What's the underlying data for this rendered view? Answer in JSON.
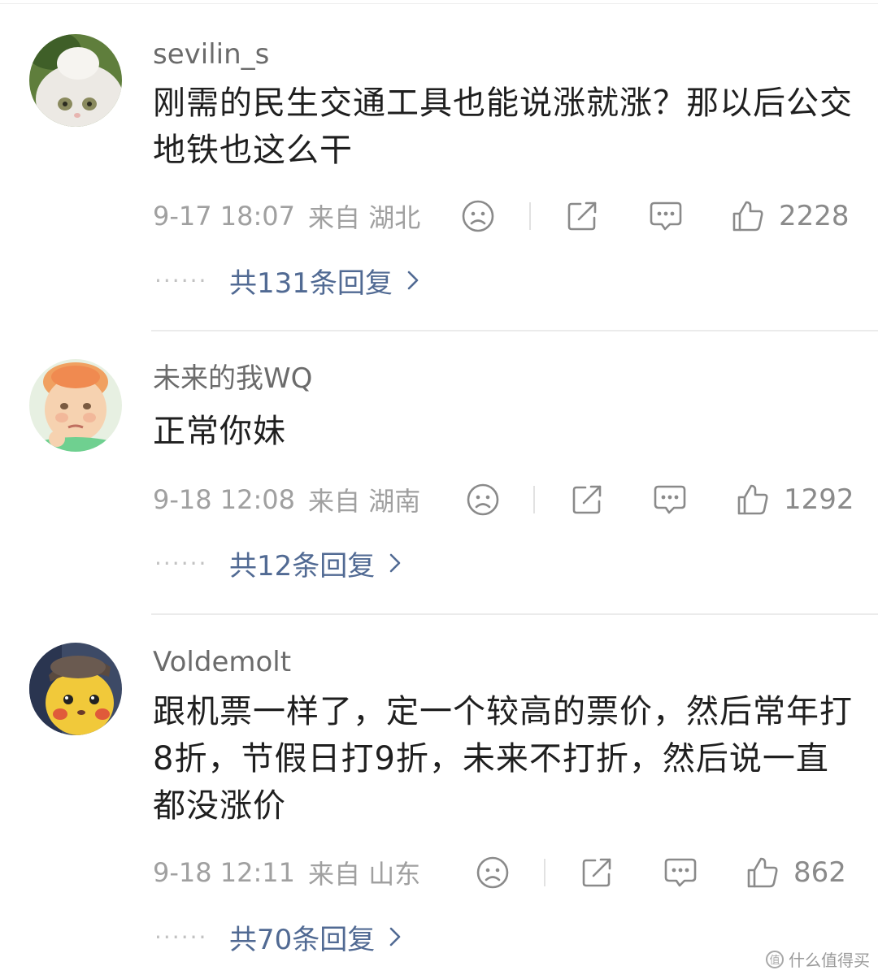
{
  "comments": [
    {
      "username": "sevilin_s",
      "text": "刚需的民生交通工具也能说涨就涨？那以后公交地铁也这么干",
      "time": "9-17 18:07",
      "location": "来自 湖北",
      "likes": "2228",
      "replies_label": "共131条回复"
    },
    {
      "username": "未来的我WQ",
      "text": "正常你妹",
      "time": "9-18 12:08",
      "location": "来自 湖南",
      "likes": "1292",
      "replies_label": "共12条回复"
    },
    {
      "username": "Voldemolt",
      "text": "跟机票一样了，定一个较高的票价，然后常年打8折，节假日打9折，未来不打折，然后说一直都没涨价",
      "time": "9-18 12:11",
      "location": "来自 山东",
      "likes": "862",
      "replies_label": "共70条回复"
    }
  ],
  "watermark": {
    "logo": "值",
    "text": "什么值得买"
  },
  "icons": [
    "sad-face-icon",
    "share-icon",
    "comment-icon",
    "thumbs-up-icon",
    "chevron-right-icon"
  ],
  "colors": {
    "link": "#516a93",
    "meta": "#a0a0a0",
    "text": "#1f1f1f",
    "username": "#6b6b6b"
  }
}
